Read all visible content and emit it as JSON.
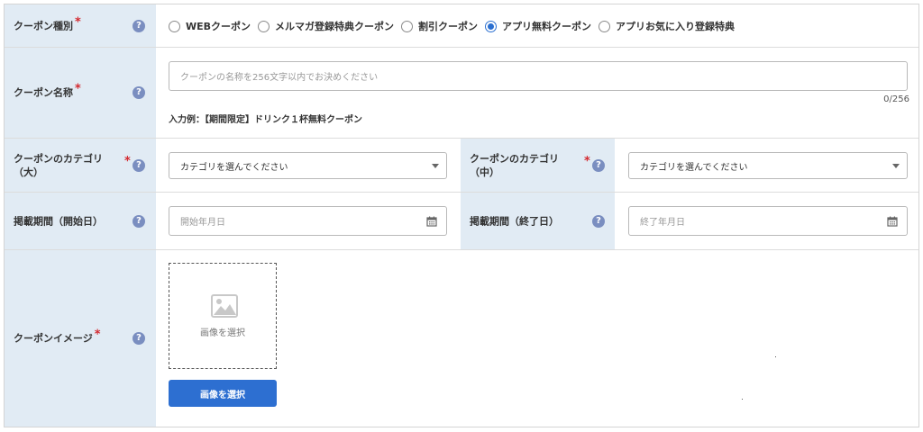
{
  "coupon_type": {
    "label": "クーポン種別",
    "options": [
      "WEBクーポン",
      "メルマガ登録特典クーポン",
      "割引クーポン",
      "アプリ無料クーポン",
      "アプリお気に入り登録特典"
    ],
    "selected": "アプリ無料クーポン"
  },
  "coupon_name": {
    "label": "クーポン名称",
    "placeholder": "クーポンの名称を256文字以内でお決めください",
    "counter": "0/256",
    "example": "入力例：【期間限定】ドリンク１杯無料クーポン"
  },
  "category_large": {
    "label_line1": "クーポンのカテゴリ",
    "label_line2": "（大）",
    "selected": "カテゴリを選んでください"
  },
  "category_medium": {
    "label_line1": "クーポンのカテゴリ",
    "label_line2": "（中）",
    "selected": "カテゴリを選んでください"
  },
  "period_start": {
    "label": "掲載期間（開始日）",
    "placeholder": "開始年月日"
  },
  "period_end": {
    "label": "掲載期間（終了日）",
    "placeholder": "終了年月日"
  },
  "coupon_image": {
    "label": "クーポンイメージ",
    "box_text": "画像を選択",
    "button_label": "画像を選択"
  },
  "common": {
    "required_mark": "*",
    "help_mark": "?"
  },
  "colors": {
    "label_bg": "#e1ebf4",
    "accent": "#2d6fd1",
    "required": "#d3282e",
    "help_icon": "#7a8ec0"
  }
}
